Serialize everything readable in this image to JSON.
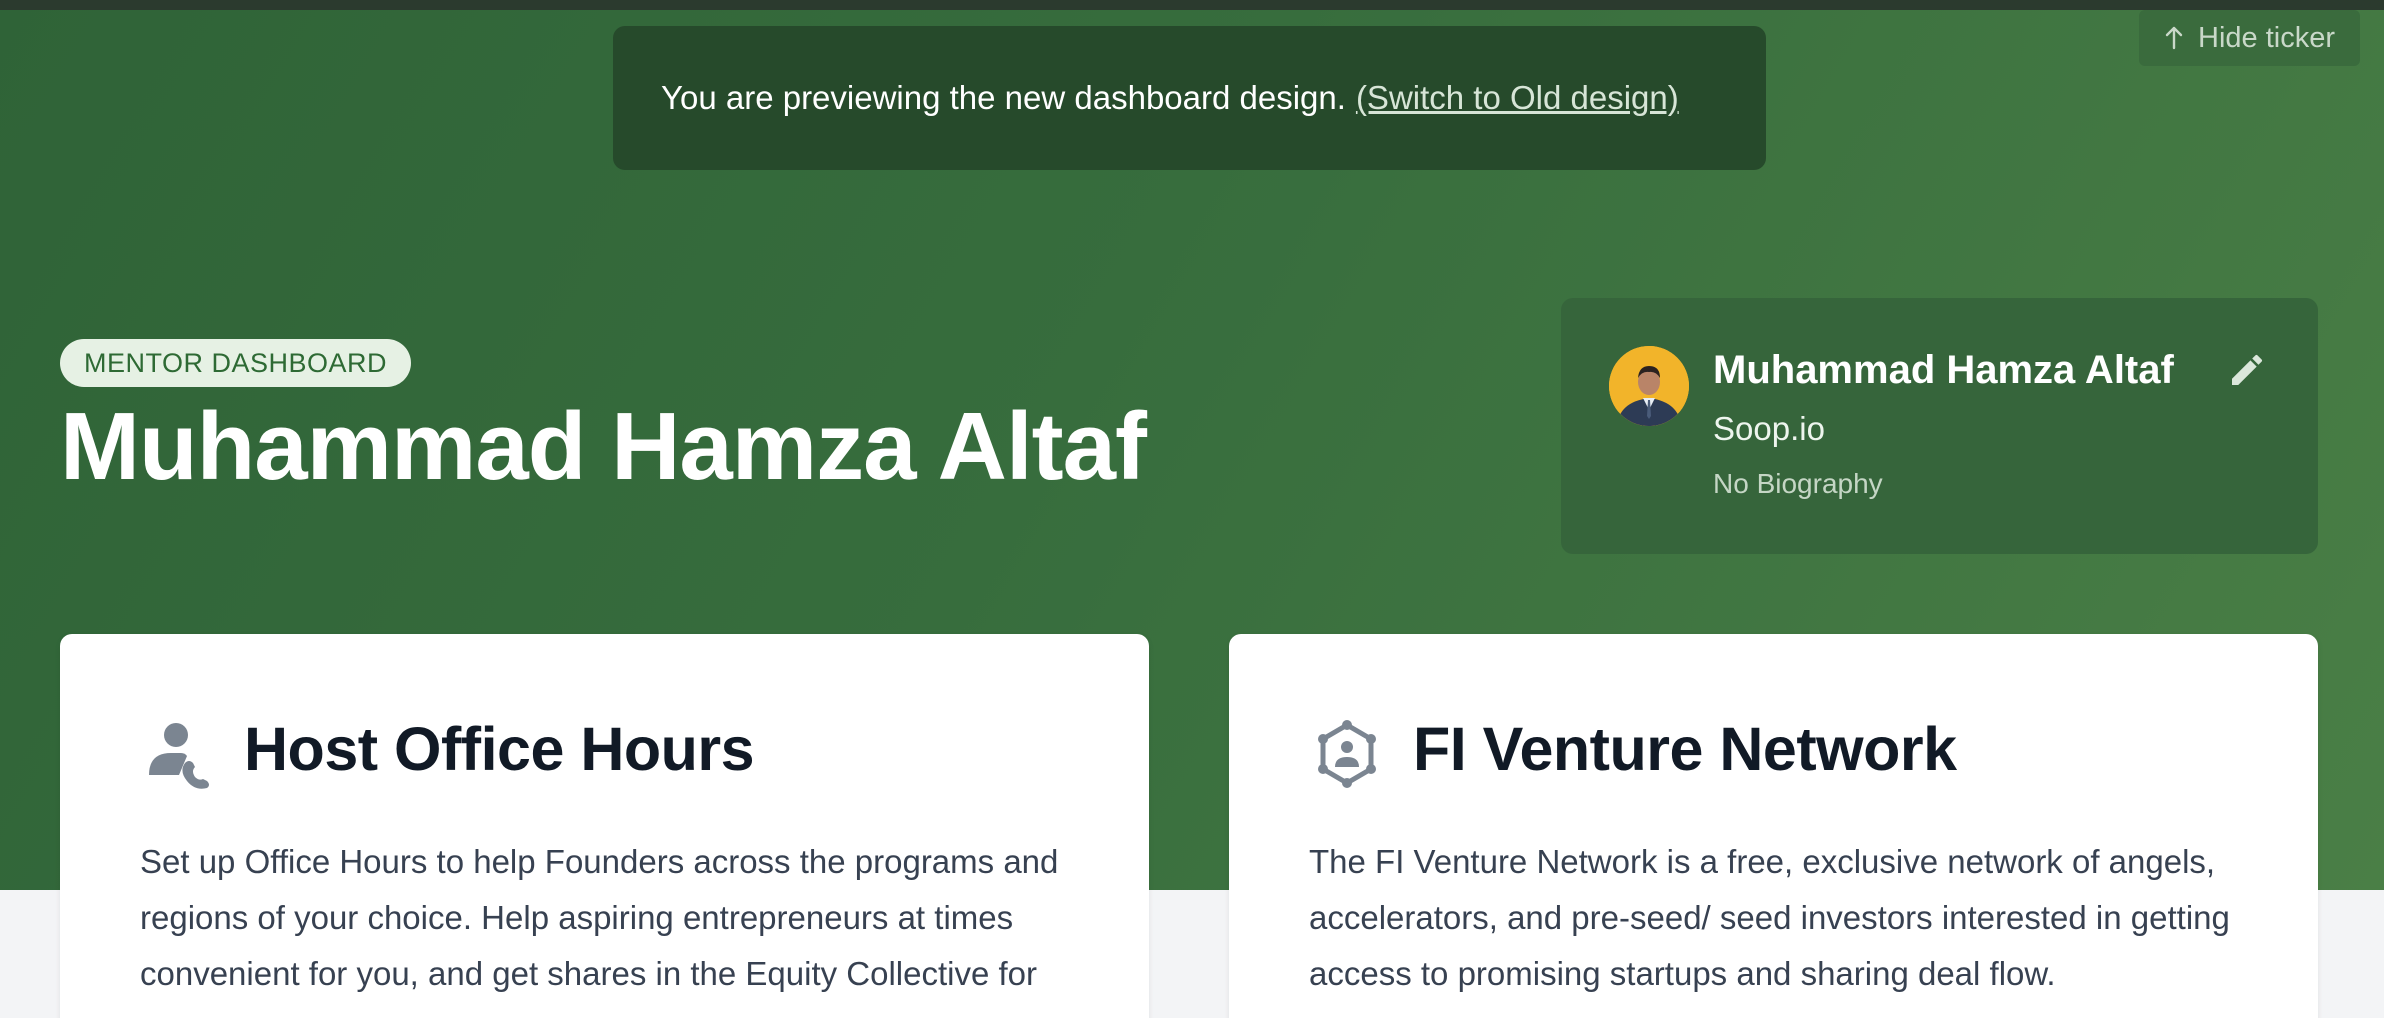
{
  "banner": {
    "message": "You are previewing the new dashboard design.",
    "switch_link": "(Switch to Old design)"
  },
  "hide_ticker": {
    "label": "Hide ticker",
    "icon": "arrow-up-icon"
  },
  "header": {
    "badge": "MENTOR DASHBOARD",
    "title": "Muhammad Hamza Altaf"
  },
  "profile": {
    "name": "Muhammad Hamza Altaf",
    "company": "Soop.io",
    "bio": "No Biography",
    "edit_icon": "pencil-icon",
    "avatar_bg": "#f2b42a"
  },
  "cards": [
    {
      "icon": "person-phone-icon",
      "title": "Host Office Hours",
      "body": "Set up Office Hours to help Founders across the programs and regions of your choice. Help aspiring entrepreneurs at times convenient for you, and get shares in the Equity Collective for"
    },
    {
      "icon": "network-hexagon-icon",
      "title": "FI Venture Network",
      "body": "The FI Venture Network is a free, exclusive network of angels, accelerators, and pre-seed/ seed investors interested in getting access to promising startups and sharing deal flow."
    }
  ],
  "colors": {
    "hero_green": "#376d3d",
    "banner_dark": "#264a2b",
    "badge_text": "#2e6a34",
    "title_dark": "#111a26"
  }
}
